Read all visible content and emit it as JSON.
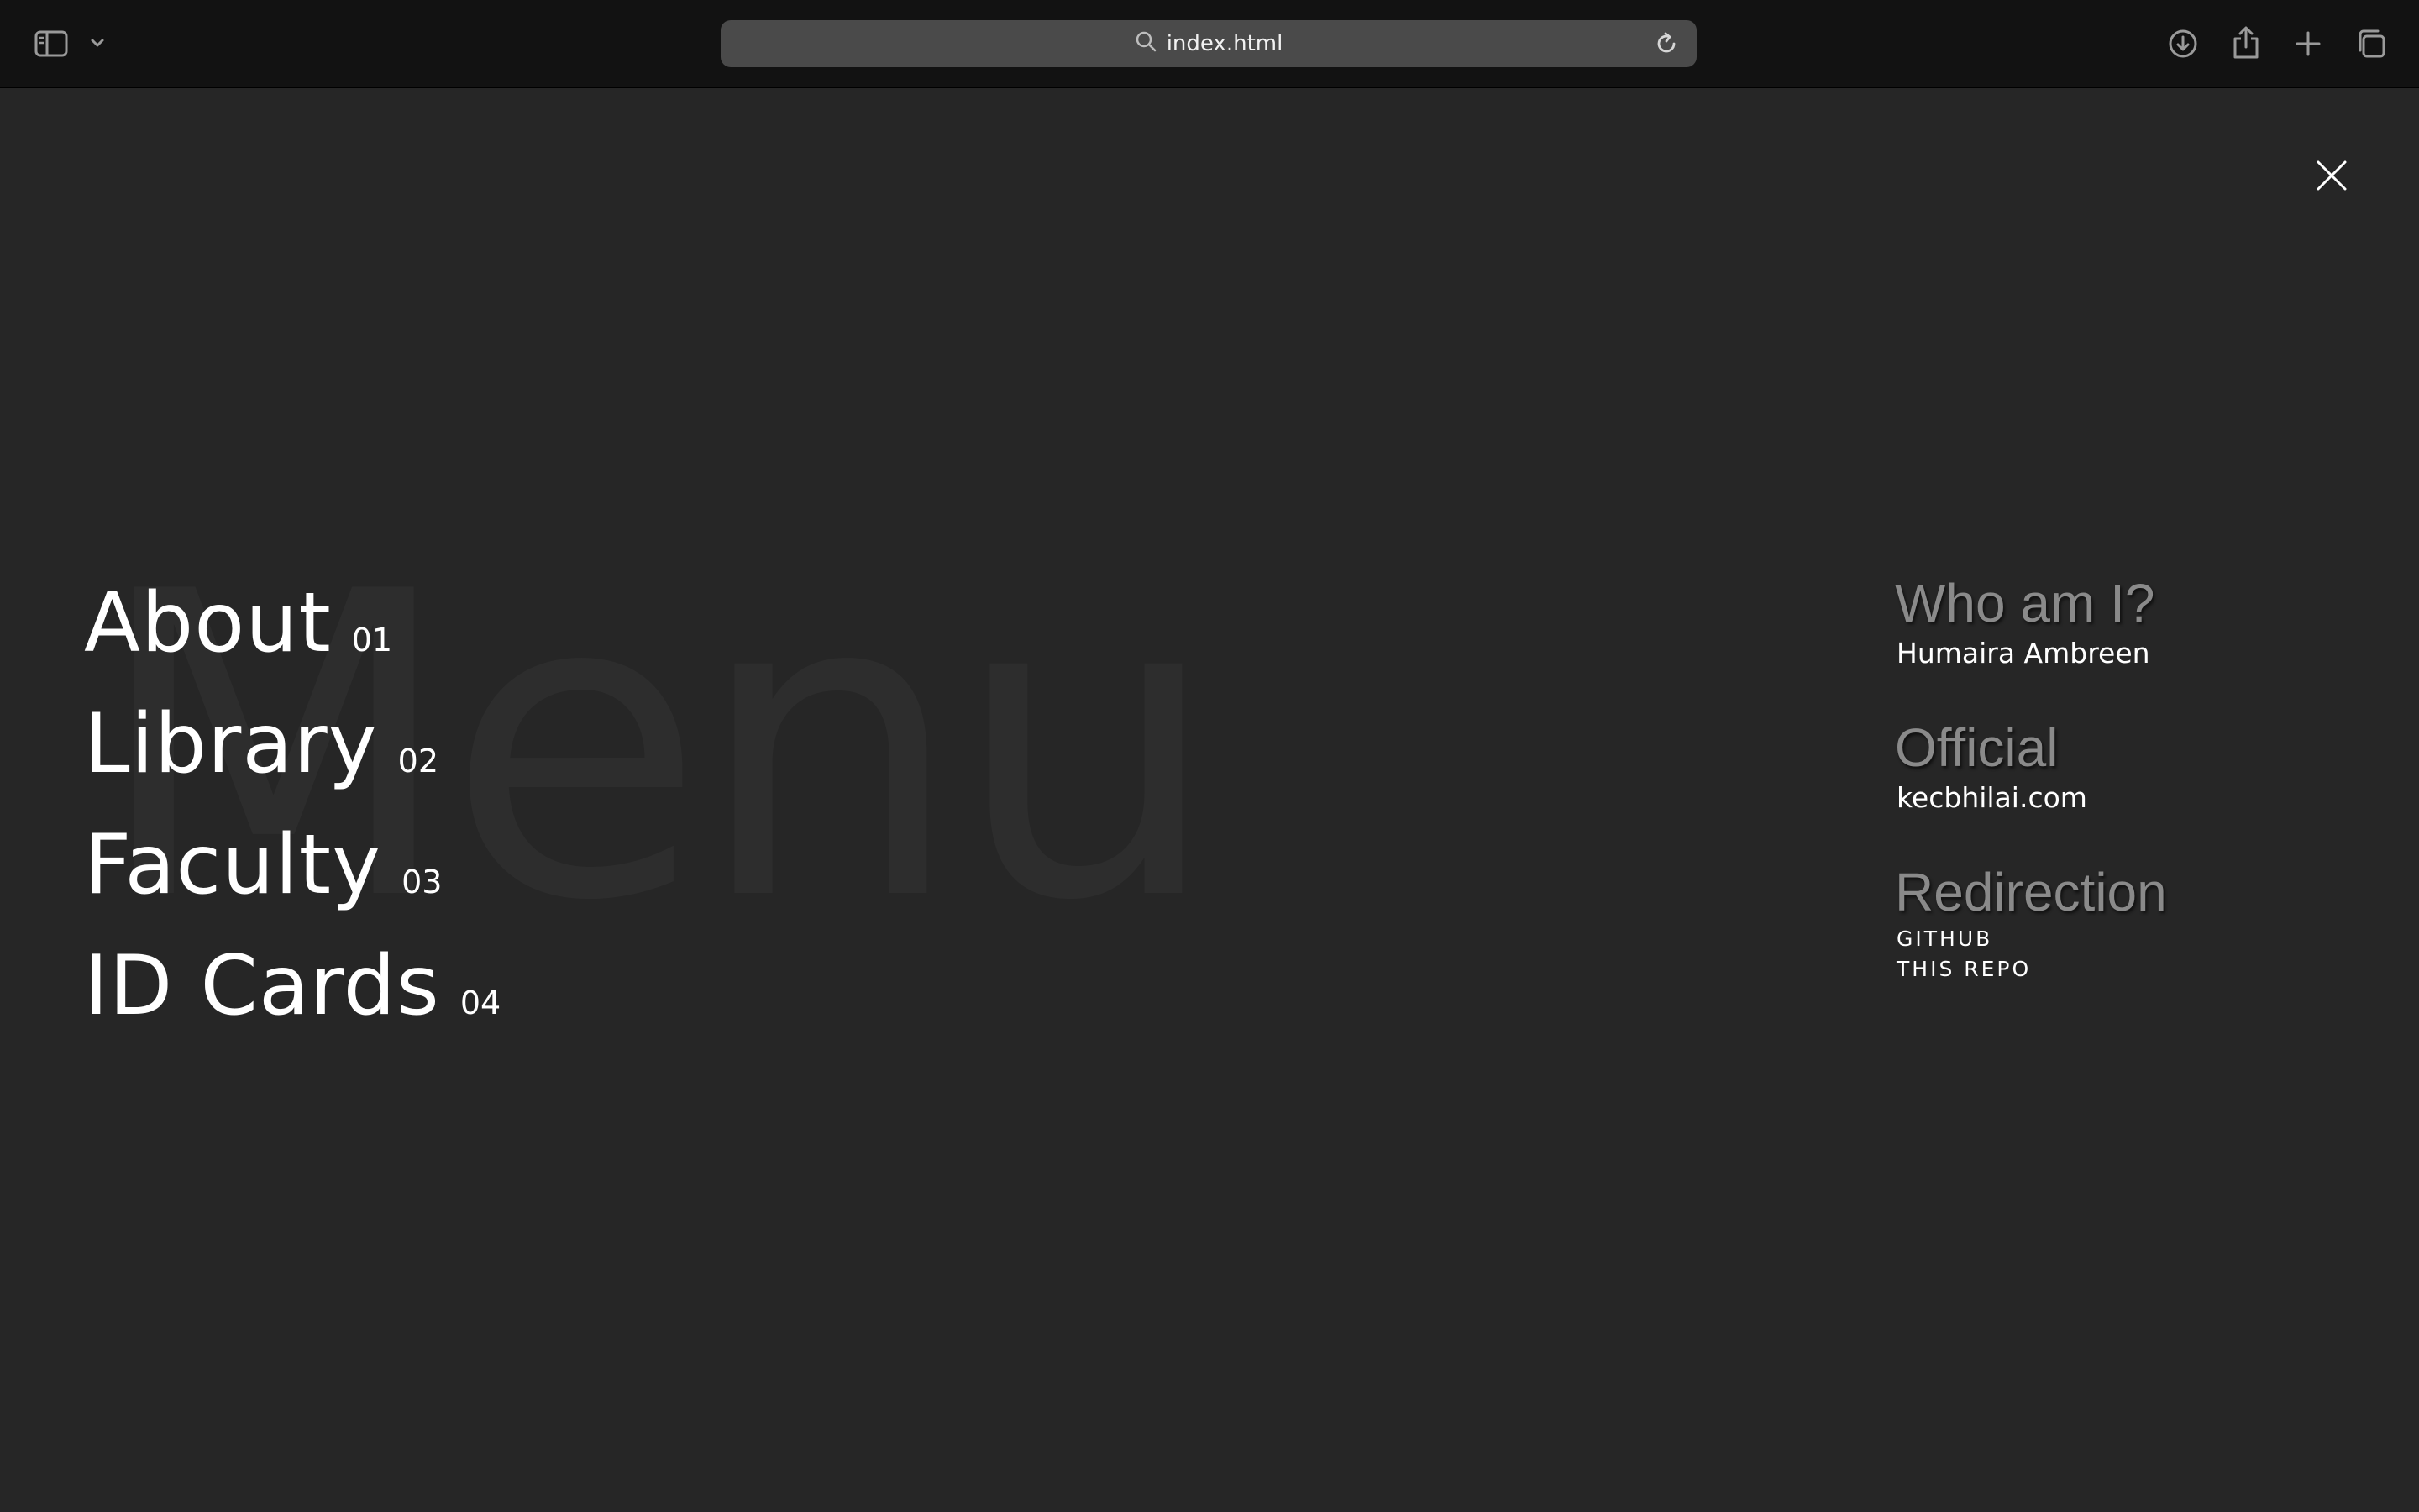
{
  "browser": {
    "address": "index.html",
    "icons": {
      "sidebar": "sidebar-icon",
      "chevron": "chevron-down-icon",
      "search": "search-icon",
      "reload": "reload-icon",
      "download": "download-icon",
      "share": "share-icon",
      "new_tab": "plus-icon",
      "tabs": "tabs-overview-icon"
    }
  },
  "page": {
    "background_word": "Menu",
    "close_icon": "close-icon",
    "menu": [
      {
        "label": "About",
        "num": "01"
      },
      {
        "label": "Library",
        "num": "02"
      },
      {
        "label": "Faculty",
        "num": "03"
      },
      {
        "label": "ID Cards",
        "num": "04"
      }
    ],
    "info": {
      "who_heading": "Who am I?",
      "who_value": "Humaira Ambreen",
      "official_heading": "Official",
      "official_value": "kecbhilai.com",
      "redirection_heading": "Redirection",
      "links": [
        "GITHUB",
        "THIS REPO"
      ]
    }
  },
  "colors": {
    "background": "#262626",
    "toolbar": "#121212",
    "address_bar": "#4a4a4a",
    "text": "#ffffff",
    "heading": "#8a8a8a",
    "background_word": "#2d2d2d"
  }
}
